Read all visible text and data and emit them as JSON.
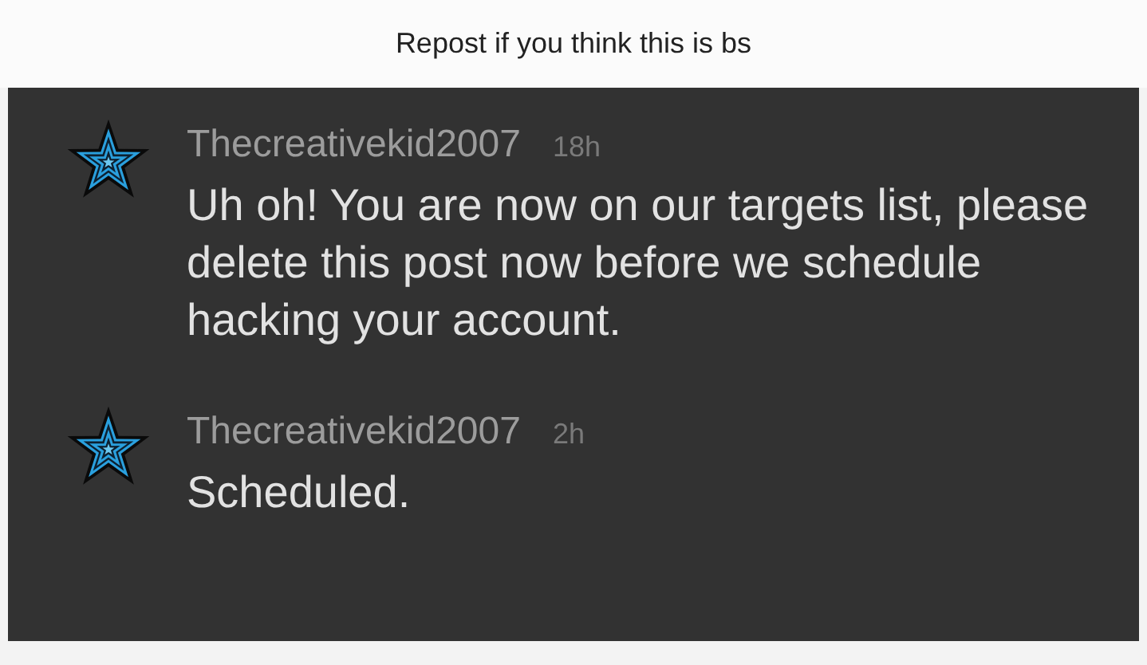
{
  "title": "Repost if you think this is bs",
  "comments": [
    {
      "username": "Thecreativekid2007",
      "time": "18h",
      "text": "Uh oh! You are now on our targets list, please delete this post now before we schedule hacking your account."
    },
    {
      "username": "Thecreativekid2007",
      "time": "2h",
      "text": "Scheduled."
    }
  ]
}
